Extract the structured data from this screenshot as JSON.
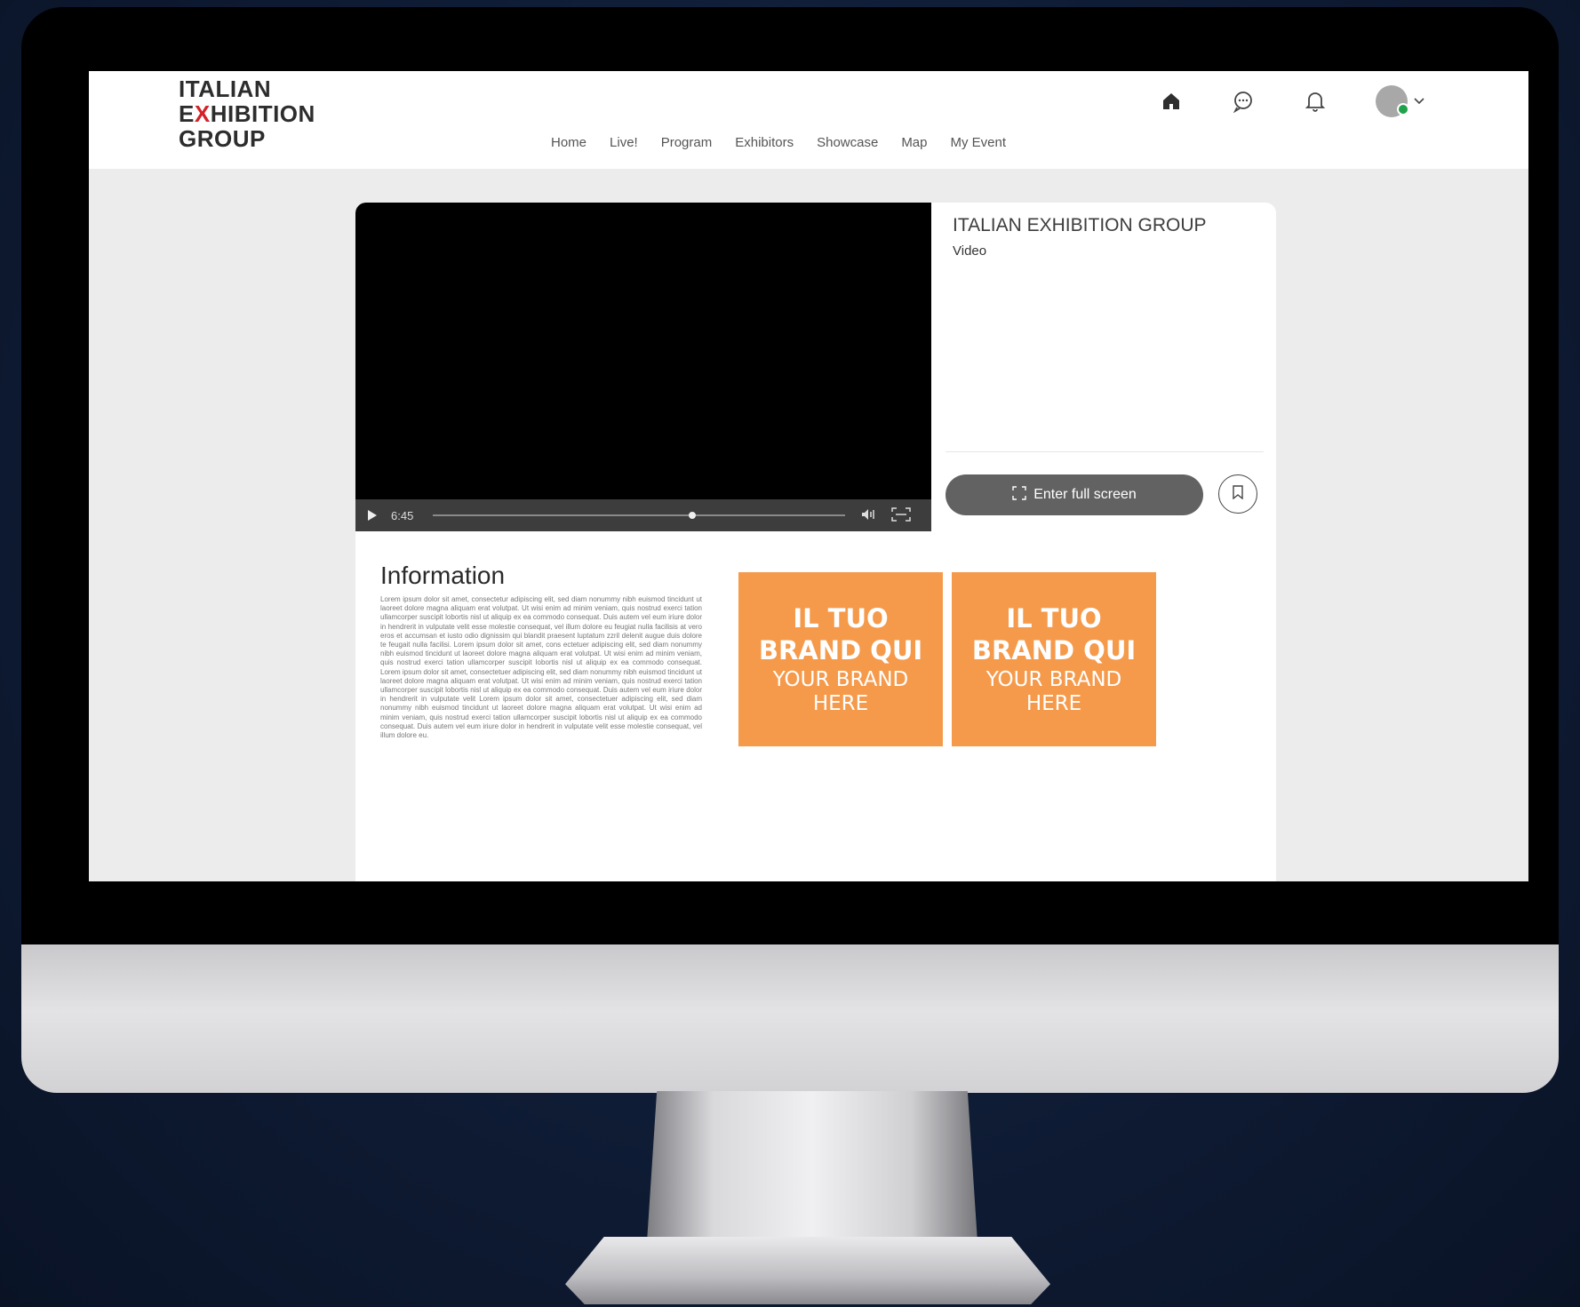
{
  "logo": {
    "line1": "ITALIAN",
    "line2_start": "E",
    "line2_x": "X",
    "line2_end": "HIBITION",
    "line3": "GROUP"
  },
  "nav": [
    "Home",
    "Live!",
    "Program",
    "Exhibitors",
    "Showcase",
    "Map",
    "My Event"
  ],
  "top_icons": [
    "home-icon",
    "chat-icon",
    "bell-icon",
    "avatar"
  ],
  "video": {
    "time": "6:45",
    "progress": 0.62
  },
  "side": {
    "title": "ITALIAN EXHIBITION GROUP",
    "subtitle": "Video",
    "fullscreen_label": "Enter full screen"
  },
  "info": {
    "title": "Information",
    "body": "Lorem ipsum dolor sit amet, consectetur adipiscing elit, sed diam nonummy nibh euismod tincidunt ut laoreet dolore magna aliquam erat volutpat. Ut wisi enim ad minim veniam, quis nostrud exerci tation ullamcorper suscipit lobortis nisl ut aliquip ex ea commodo consequat. Duis autem vel eum iriure dolor in hendrerit in vulputate velit esse molestie consequat, vel illum dolore eu feugiat nulla facilisis at vero eros et accumsan et iusto odio dignissim qui blandit praesent luptatum zzril delenit augue duis dolore te feugait nulla facilisi. Lorem ipsum dolor sit amet, cons ectetuer adipiscing elit, sed diam nonummy nibh euismod tincidunt ut laoreet dolore magna aliquam erat volutpat. Ut wisi enim ad minim veniam, quis nostrud exerci tation ullamcorper suscipit lobortis nisl ut aliquip ex ea commodo consequat. Lorem ipsum dolor sit amet, consectetuer adipiscing elit, sed diam nonummy nibh euismod tincidunt ut laoreet dolore magna aliquam erat volutpat. Ut wisi enim ad minim veniam, quis nostrud exerci tation ullamcorper suscipit lobortis nisl ut aliquip ex ea commodo consequat. Duis autem vel eum iriure dolor in hendrerit in vulputate velit Lorem ipsum dolor sit amet, consectetuer adipiscing elit, sed diam nonummy nibh euismod tincidunt ut laoreet dolore magna aliquam erat volutpat. Ut wisi enim ad minim veniam, quis nostrud exerci tation ullamcorper suscipit lobortis nisl ut aliquip ex ea commodo consequat. Duis autem vel eum iriure dolor in hendrerit in vulputate velit esse molestie consequat, vel illum dolore eu."
  },
  "brand_tiles": [
    {
      "line1": "IL TUO",
      "line2": "BRAND QUI",
      "line3": "YOUR BRAND",
      "line4": "HERE"
    },
    {
      "line1": "IL TUO",
      "line2": "BRAND QUI",
      "line3": "YOUR BRAND",
      "line4": "HERE"
    }
  ],
  "colors": {
    "brand_tile": "#f59a4b",
    "logo_accent": "#d3232a",
    "online_dot": "#1fa34a"
  }
}
